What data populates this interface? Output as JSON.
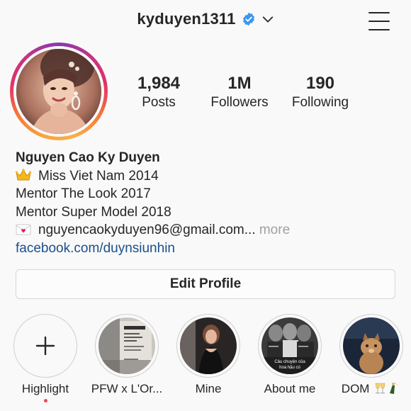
{
  "header": {
    "username": "kyduyen1311",
    "verified": true
  },
  "colors": {
    "verified_blue": "#3897f0",
    "link_blue": "#1b4f8a",
    "notification_red": "#ed4956",
    "muted_gray": "#a0a0a0"
  },
  "stats": [
    {
      "value": "1,984",
      "label": "Posts"
    },
    {
      "value": "1M",
      "label": "Followers"
    },
    {
      "value": "190",
      "label": "Following"
    }
  ],
  "bio": {
    "name": "Nguyen Cao Ky Duyen",
    "lines": [
      {
        "icon": "crown-emoji-icon",
        "text": "Miss Viet Nam 2014"
      },
      {
        "text": "Mentor The Look 2017"
      },
      {
        "text": "Mentor Super Model 2018"
      }
    ],
    "email_line": {
      "icon": "love-letter-emoji-icon",
      "text": "nguyencaokyduyen96@gmail.com...",
      "more": "more"
    },
    "link": "facebook.com/duynsiunhin"
  },
  "edit_profile_label": "Edit Profile",
  "highlights": [
    {
      "label": "Highlight",
      "icon": "plus-icon"
    },
    {
      "label": "PFW x L'Or..."
    },
    {
      "label": "Mine"
    },
    {
      "label": "About me",
      "overlay": [
        "Câu chuyện của",
        "hoa hậu có"
      ]
    },
    {
      "label": "DOM",
      "emoji": "champagne-emoji-icon"
    }
  ]
}
